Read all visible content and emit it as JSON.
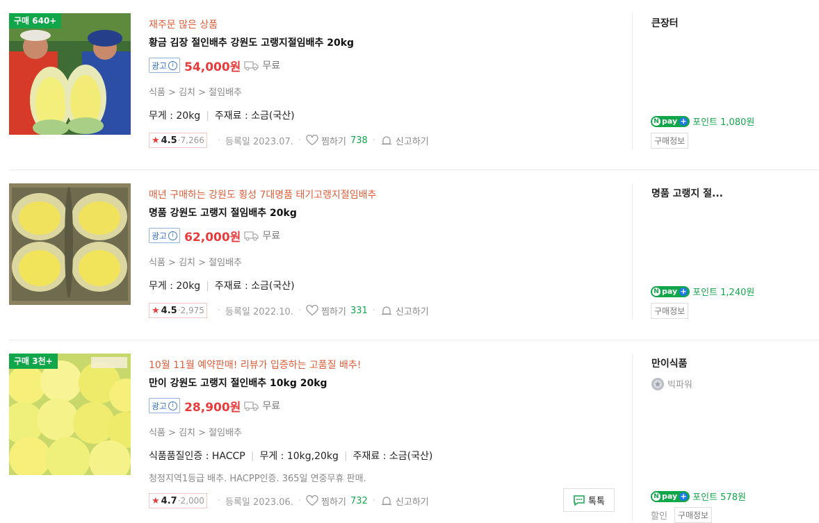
{
  "products": [
    {
      "badge": "구매 640+",
      "promo": "재주문 많은 상품",
      "title": "황금 김장 절인배추 강원도 고랭지절임배추 20kg",
      "ad_label": "광고",
      "ad_icon": "i",
      "price": "54,000원",
      "shipping": "무료",
      "category": "식품 > 김치 > 절임배추",
      "specs": [
        "무게 : 20kg",
        "주재료 : 소금(국산)"
      ],
      "rating": "4.5",
      "review_count": "7,266",
      "registered": "등록일 2023.07.",
      "wish_label": "찜하기",
      "wish_count": "738",
      "report_label": "신고하기",
      "seller": "큰장터",
      "npay_label": "pay",
      "points": "포인트 1,080원",
      "buy_info": "구매정보"
    },
    {
      "promo": "매년 구매하는 강원도 횡성 7대명품 태기고랭지절임배추",
      "title": "명품 강원도 고랭지 절임배추 20kg",
      "ad_label": "광고",
      "ad_icon": "i",
      "price": "62,000원",
      "shipping": "무료",
      "category": "식품 > 김치 > 절임배추",
      "specs": [
        "무게 : 20kg",
        "주재료 : 소금(국산)"
      ],
      "rating": "4.5",
      "review_count": "2,975",
      "registered": "등록일 2022.10.",
      "wish_label": "찜하기",
      "wish_count": "331",
      "report_label": "신고하기",
      "seller": "명품 고랭지 절...",
      "npay_label": "pay",
      "points": "포인트 1,240원",
      "buy_info": "구매정보"
    },
    {
      "badge": "구매 3천+",
      "promo": "10월 11월 예약판매! 리뷰가 입증하는 고품질 배추!",
      "title": "만이 강원도 고랭지 절인배추 10kg 20kg",
      "ad_label": "광고",
      "ad_icon": "i",
      "price": "28,900원",
      "shipping": "무료",
      "category": "식품 > 김치 > 절임배추",
      "specs": [
        "식품품질인증 : HACCP",
        "무게 : 10kg,20kg",
        "주재료 : 소금(국산)"
      ],
      "description": "청정지역1등급 배추. HACPP인증. 365일 연중무휴 판매.",
      "rating": "4.7",
      "review_count": "2,000",
      "registered": "등록일 2023.06.",
      "wish_label": "찜하기",
      "wish_count": "732",
      "report_label": "신고하기",
      "talk_label": "톡톡",
      "seller": "만이식품",
      "seller_grade": "빅파워",
      "npay_label": "pay",
      "points": "포인트 578원",
      "discount_label": "할인",
      "buy_info": "구매정보"
    }
  ],
  "colors": {
    "accent_green": "#12a64b",
    "price_red": "#e83b3b",
    "promo_orange": "#e05d3a",
    "ad_blue": "#3d74c4"
  }
}
